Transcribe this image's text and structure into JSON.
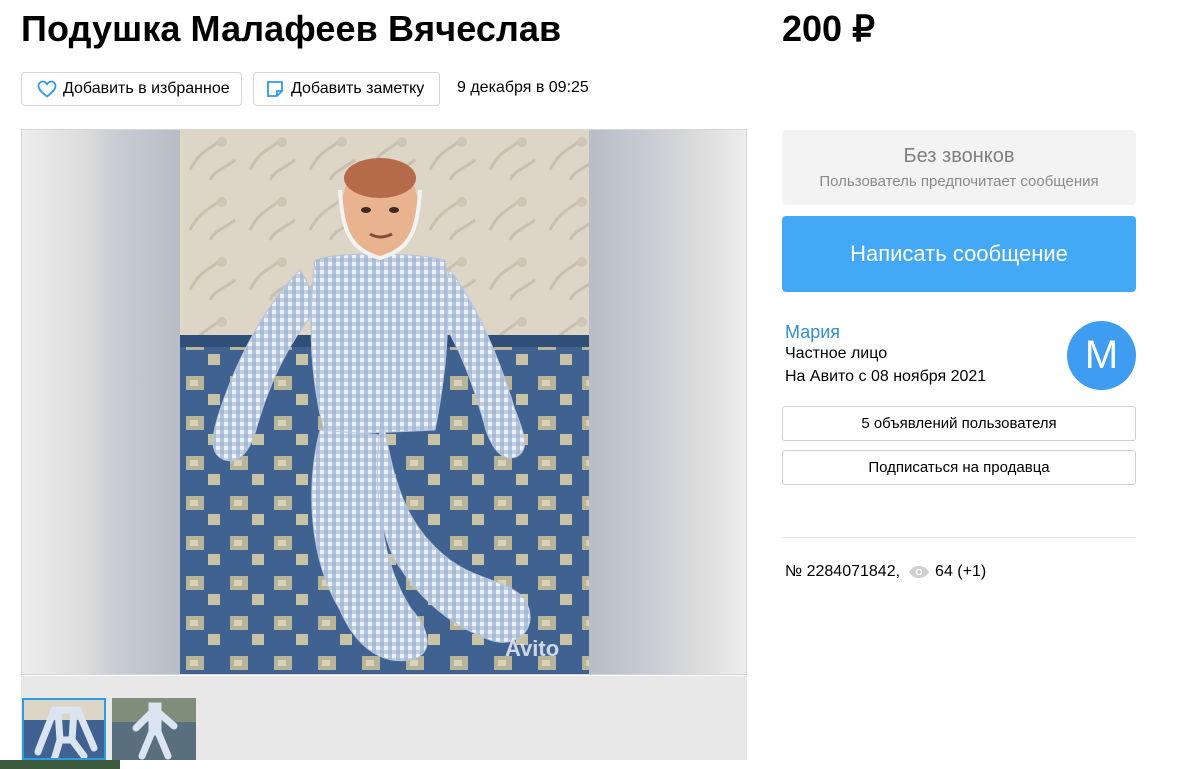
{
  "listing": {
    "title": "Подушка Малафеев Вячеслав",
    "price": "200 ₽",
    "favorite_label": "Добавить в избранное",
    "note_label": "Добавить заметку",
    "date": "9 декабря в 09:25",
    "id_text": "№ 2284071842,",
    "views": "64 (+1)",
    "watermark": "Avito"
  },
  "contact": {
    "no_calls_title": "Без звонков",
    "no_calls_sub": "Пользователь предпочитает сообщения",
    "write_button": "Написать сообщение"
  },
  "seller": {
    "name": "Мария",
    "type": "Частное лицо",
    "since": "На Авито с 08 ноября 2021",
    "avatar_letter": "М",
    "ads_button": "5 объявлений пользователя",
    "subscribe_button": "Подписаться на продавца"
  },
  "icons": [
    "heart-icon",
    "note-icon",
    "eye-icon"
  ],
  "colors": {
    "accent": "#43a8f5",
    "link": "#2d8fd6",
    "avatar": "#3e9df0",
    "thumb_border": "#2d9be8"
  }
}
